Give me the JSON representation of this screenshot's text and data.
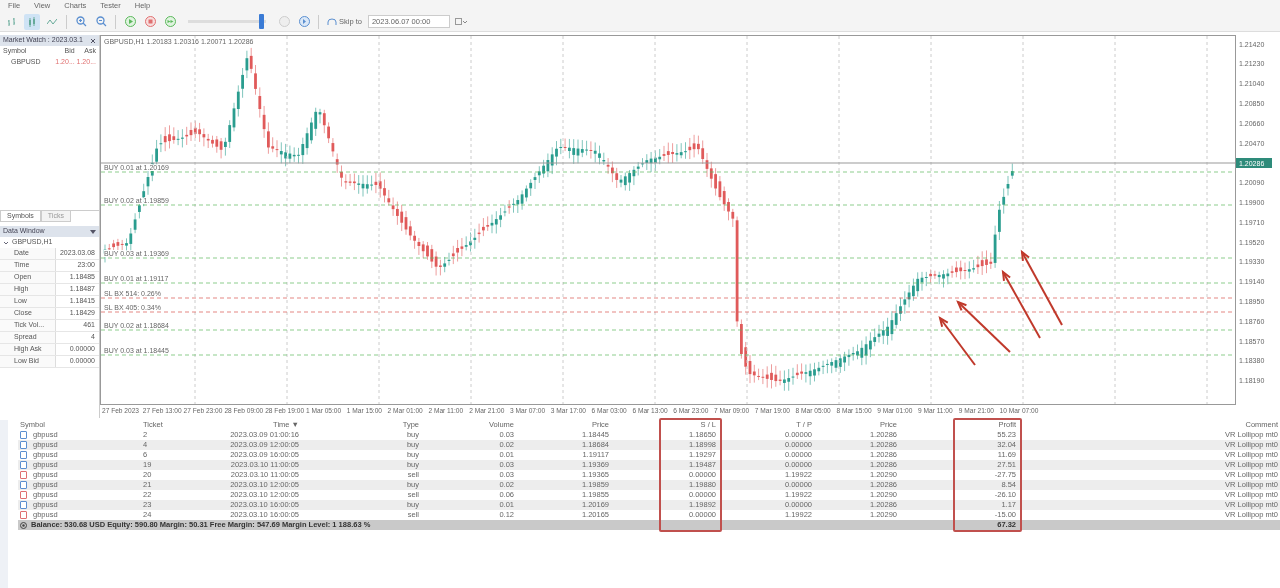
{
  "menu": [
    "File",
    "View",
    "Charts",
    "Tester",
    "Help"
  ],
  "toolbar": {
    "chart_types": [
      {
        "selected": false
      },
      {
        "selected": true
      },
      {
        "selected": false
      }
    ],
    "speed": {
      "level": 0.95
    },
    "skip_label": "Skip to",
    "date": "2023.06.07 00:00"
  },
  "market_watch": {
    "title": "Market Watch : 2023.03.1",
    "columns": [
      "Symbol",
      "Bid",
      "Ask"
    ],
    "rows": [
      {
        "symbol": "GBPUSD",
        "bid": "1.20...",
        "ask": "1.20..."
      }
    ],
    "tabs": [
      {
        "label": "Symbols",
        "selected": true
      },
      {
        "label": "Ticks",
        "selected": false
      }
    ]
  },
  "data_window": {
    "title": "Data Window",
    "symbol": "GBPUSD,H1",
    "expanded": true,
    "rows": [
      {
        "label": "Date",
        "value": "2023.03.08"
      },
      {
        "label": "Time",
        "value": "23:00"
      },
      {
        "label": "Open",
        "value": "1.18485"
      },
      {
        "label": "High",
        "value": "1.18487"
      },
      {
        "label": "Low",
        "value": "1.18415"
      },
      {
        "label": "Close",
        "value": "1.18429"
      },
      {
        "label": "Tick Vol...",
        "value": "461"
      },
      {
        "label": "Spread",
        "value": "4"
      },
      {
        "label": "High Ask",
        "value": "0.00000"
      },
      {
        "label": "Low Bid",
        "value": "0.00000"
      }
    ]
  },
  "chart": {
    "header": "GBPUSD,H1 1.20183 1.20316 1.20071 1.20286",
    "current_price": "1.20286",
    "price_labels": [
      "1.21420",
      "1.21230",
      "1.21040",
      "1.20850",
      "1.20660",
      "1.20470",
      "1.20090",
      "1.19900",
      "1.19710",
      "1.19520",
      "1.19330",
      "1.19140",
      "1.18950",
      "1.18760",
      "1.18570",
      "1.18380",
      "1.18190"
    ],
    "time_labels": [
      "27 Feb 2023",
      "27 Feb 13:00",
      "27 Feb 23:00",
      "28 Feb 09:00",
      "28 Feb 19:00",
      "1 Mar 05:00",
      "1 Mar 15:00",
      "2 Mar 01:00",
      "2 Mar 11:00",
      "2 Mar 21:00",
      "3 Mar 07:00",
      "3 Mar 17:00",
      "6 Mar 03:00",
      "6 Mar 13:00",
      "6 Mar 23:00",
      "7 Mar 09:00",
      "7 Mar 19:00",
      "8 Mar 05:00",
      "8 Mar 15:00",
      "9 Mar 01:00",
      "9 Mar 11:00",
      "9 Mar 21:00",
      "10 Mar 07:00"
    ],
    "order_lines": [
      {
        "label": "BUY 0.01 at 1.20169",
        "kind": "buy"
      },
      {
        "label": "BUY 0.02 at 1.19859",
        "kind": "buy"
      },
      {
        "label": "BUY 0.03 at 1.19369",
        "kind": "buy"
      },
      {
        "label": "BUY 0.01 at 1.19117",
        "kind": "buy"
      },
      {
        "label": "SL BX 514: 0.26%",
        "kind": "sl"
      },
      {
        "label": "SL BX 405: 0.34%",
        "kind": "sl"
      },
      {
        "label": "BUY 0.02 at 1.18684",
        "kind": "buy"
      },
      {
        "label": "BUY 0.03 at 1.18445",
        "kind": "buy"
      }
    ]
  },
  "trades": {
    "columns": [
      {
        "label": "Symbol",
        "highlighted": false
      },
      {
        "label": "Ticket",
        "highlighted": false
      },
      {
        "label": "Time ▼",
        "highlighted": false
      },
      {
        "label": "Type",
        "highlighted": false
      },
      {
        "label": "Volume",
        "highlighted": false
      },
      {
        "label": "Price",
        "highlighted": false
      },
      {
        "label": "S / L",
        "highlighted": true
      },
      {
        "label": "T / P",
        "highlighted": false
      },
      {
        "label": "Price",
        "highlighted": false
      },
      {
        "label": "Profit",
        "highlighted": true
      },
      {
        "label": "Comment",
        "highlighted": false
      }
    ],
    "rows": [
      {
        "kind": "buy",
        "cells": [
          "gbpusd",
          "2",
          "2023.03.09 01:00:16",
          "buy",
          "0.03",
          "1.18445",
          "1.18650",
          "0.00000",
          "1.20286",
          "55.23",
          "VR Lollipop mt0"
        ]
      },
      {
        "kind": "buy",
        "cells": [
          "gbpusd",
          "4",
          "2023.03.09 12:00:05",
          "buy",
          "0.02",
          "1.18684",
          "1.18998",
          "0.00000",
          "1.20286",
          "32.04",
          "VR Lollipop mt0"
        ]
      },
      {
        "kind": "buy",
        "cells": [
          "gbpusd",
          "6",
          "2023.03.09 16:00:05",
          "buy",
          "0.01",
          "1.19117",
          "1.19297",
          "0.00000",
          "1.20286",
          "11.69",
          "VR Lollipop mt0"
        ]
      },
      {
        "kind": "buy",
        "cells": [
          "gbpusd",
          "19",
          "2023.03.10 11:00:05",
          "buy",
          "0.03",
          "1.19369",
          "1.19487",
          "0.00000",
          "1.20286",
          "27.51",
          "VR Lollipop mt0"
        ]
      },
      {
        "kind": "sell",
        "cells": [
          "gbpusd",
          "20",
          "2023.03.10 11:00:05",
          "sell",
          "0.03",
          "1.19365",
          "0.00000",
          "1.19922",
          "1.20290",
          "-27.75",
          "VR Lollipop mt0"
        ]
      },
      {
        "kind": "buy",
        "cells": [
          "gbpusd",
          "21",
          "2023.03.10 12:00:05",
          "buy",
          "0.02",
          "1.19859",
          "1.19880",
          "0.00000",
          "1.20286",
          "8.54",
          "VR Lollipop mt0"
        ]
      },
      {
        "kind": "sell",
        "cells": [
          "gbpusd",
          "22",
          "2023.03.10 12:00:05",
          "sell",
          "0.06",
          "1.19855",
          "0.00000",
          "1.19922",
          "1.20290",
          "-26.10",
          "VR Lollipop mt0"
        ]
      },
      {
        "kind": "buy",
        "cells": [
          "gbpusd",
          "23",
          "2023.03.10 16:00:05",
          "buy",
          "0.01",
          "1.20169",
          "1.19892",
          "0.00000",
          "1.20286",
          "1.17",
          "VR Lollipop mt0"
        ]
      },
      {
        "kind": "sell",
        "cells": [
          "gbpusd",
          "24",
          "2023.03.10 16:00:05",
          "sell",
          "0.12",
          "1.20165",
          "0.00000",
          "1.19922",
          "1.20290",
          "-15.00",
          "VR Lollipop mt0"
        ]
      }
    ],
    "summary": "Balance: 530.68 USD  Equity: 590.80  Margin: 50.31  Free Margin: 547.69  Margin Level: 1 188.63 %",
    "total_profit": "67.32"
  }
}
